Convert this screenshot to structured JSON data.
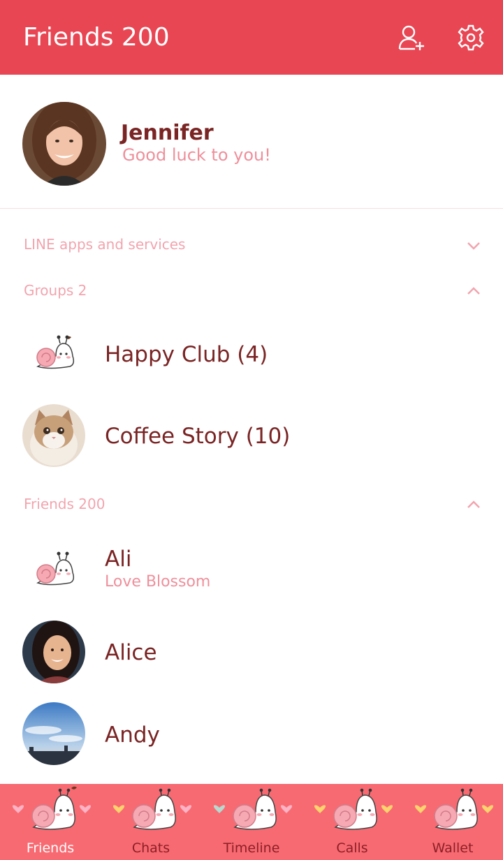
{
  "header": {
    "title": "Friends 200",
    "add_friend_icon": "add-friend-icon",
    "settings_icon": "gear-icon"
  },
  "profile": {
    "name": "Jennifer",
    "status": "Good luck to you!"
  },
  "sections": {
    "services": {
      "label": "LINE apps and services",
      "state": "collapsed"
    },
    "groups": {
      "label": "Groups 2",
      "state": "expanded"
    },
    "friends": {
      "label": "Friends 200",
      "state": "expanded"
    }
  },
  "groups": [
    {
      "name": "Happy Club (4)"
    },
    {
      "name": "Coffee Story (10)"
    }
  ],
  "friends": [
    {
      "name": "Ali",
      "status": "Love Blossom"
    },
    {
      "name": "Alice"
    },
    {
      "name": "Andy"
    }
  ],
  "tabs": [
    {
      "label": "Friends",
      "active": true,
      "heart_left": "#ffb3c4",
      "heart_right": "#ffb3c4"
    },
    {
      "label": "Chats",
      "active": false,
      "heart_left": "#ffd36e",
      "heart_right": "#ffb3c4"
    },
    {
      "label": "Timeline",
      "active": false,
      "heart_left": "#b6d9d0",
      "heart_right": "#ffb3c4"
    },
    {
      "label": "Calls",
      "active": false,
      "heart_left": "#ffd36e",
      "heart_right": "#ffd36e"
    },
    {
      "label": "Wallet",
      "active": false,
      "heart_left": "#ffd36e",
      "heart_right": "#ffd36e"
    }
  ],
  "colors": {
    "header": "#e84653",
    "tabbar": "#f86a72",
    "name_text": "#7a2424",
    "accent_text": "#ef8f9b"
  }
}
